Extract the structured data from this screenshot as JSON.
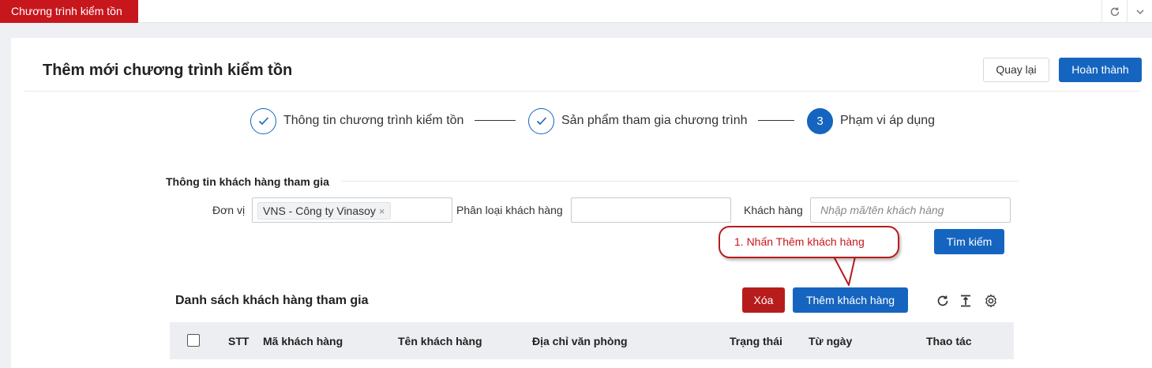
{
  "app_tab": {
    "label": "Chương trình kiểm tồn",
    "color": "#c8161d"
  },
  "topbar": {
    "icons": [
      "refresh-icon",
      "chevron-down-icon"
    ]
  },
  "header": {
    "title": "Thêm mới chương trình kiểm tồn",
    "back_label": "Quay lại",
    "done_label": "Hoàn thành"
  },
  "stepper": {
    "steps": [
      {
        "label": "Thông tin chương trình kiểm tồn",
        "state": "done"
      },
      {
        "label": "Sản phẩm tham gia chương trình",
        "state": "done"
      },
      {
        "number": "3",
        "label": "Phạm vi áp dụng",
        "state": "active"
      }
    ]
  },
  "filter": {
    "section_title": "Thông tin khách hàng tham gia",
    "unit_label": "Đơn vị",
    "unit_chip": "VNS - Công ty Vinasoy",
    "chip_remove": "×",
    "customer_type_label": "Phân loại khách hàng",
    "customer_type_value": "",
    "customer_label": "Khách hàng",
    "customer_placeholder": "Nhập mã/tên khách hàng",
    "search_label": "Tìm kiếm"
  },
  "callout": {
    "text": "1. Nhấn Thêm khách hàng"
  },
  "list": {
    "title": "Danh sách khách hàng tham gia",
    "delete_label": "Xóa",
    "add_label": "Thêm khách hàng",
    "tool_icons": [
      "refresh-icon",
      "export-icon",
      "settings-icon"
    ],
    "columns": [
      "STT",
      "Mã khách hàng",
      "Tên khách hàng",
      "Địa chỉ văn phòng",
      "Trạng thái",
      "Từ ngày",
      "Thao tác"
    ]
  },
  "colors": {
    "primary": "#1565c0",
    "danger": "#b71c1c",
    "brand_red": "#c8161d"
  }
}
